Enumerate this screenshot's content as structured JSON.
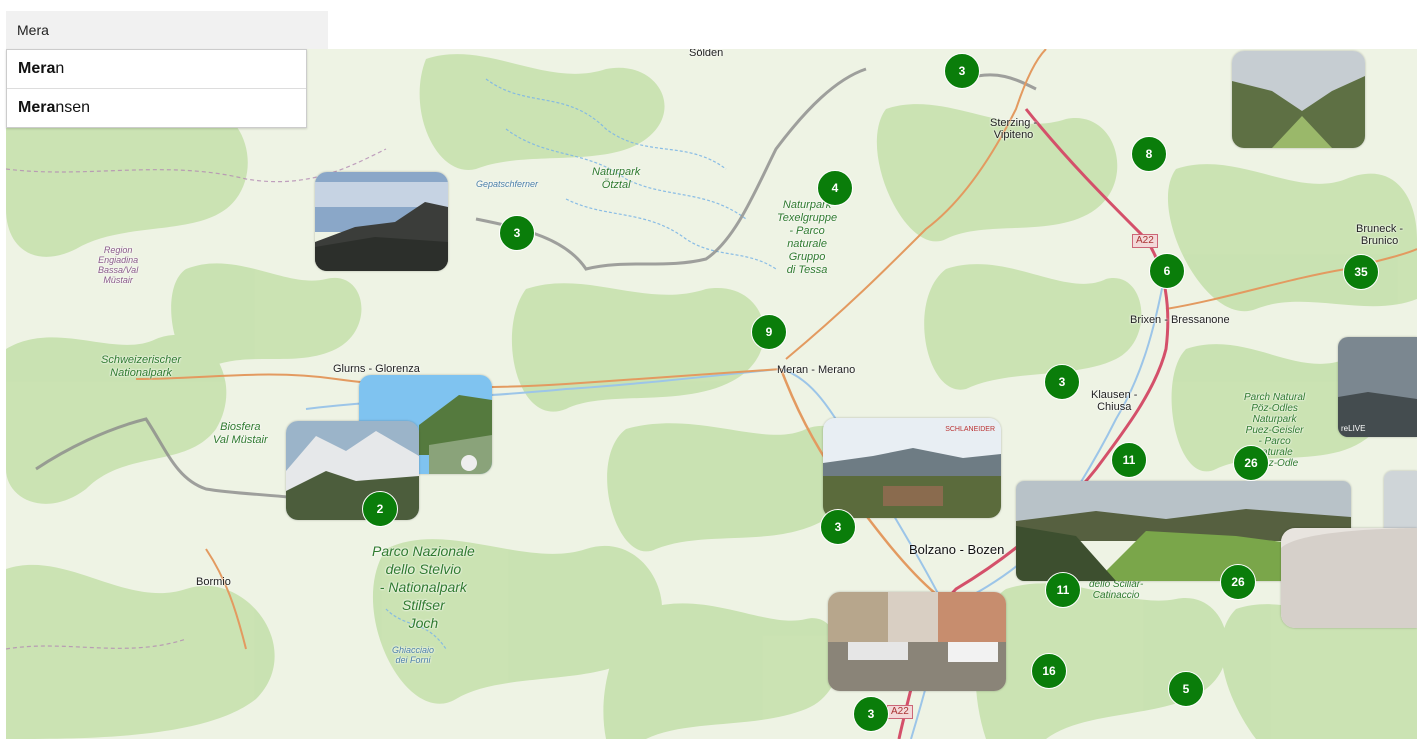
{
  "search": {
    "value": "Mera",
    "placeholder": ""
  },
  "suggestions": [
    {
      "match": "Mera",
      "rest": "n"
    },
    {
      "match": "Mera",
      "rest": "nsen"
    }
  ],
  "places": {
    "soelden": "Sölden",
    "sterzing": "Sterzing -\nVipiteno",
    "bruneck": "Bruneck -\nBrunico",
    "brixen": "Brixen - Bressanone",
    "klausen": "Klausen -\nChiusa",
    "meran": "Meran - Merano",
    "glurns": "Glurns - Glorenza",
    "bolzano": "Bolzano - Bozen",
    "bormio": "Bormio"
  },
  "parks": {
    "oetztal": "Naturpark\nÖtztal",
    "texel": "Naturpark\nTexelgruppe\n- Parco\nnaturale\nGruppo\ndi Tessa",
    "schweiz": "Schweizerischer\nNationalpark",
    "biosfera": "Biosfera\nVal Müstair",
    "stelvio": "Parco Nazionale\ndello Stelvio\n- Nationalpark\nStilfser\nJoch",
    "puez": "Parch Natural\nPöz-Odles\nNaturpark\nPuez-Geisler\n- Parco\nnaturale\nPuez-Odle",
    "sciliar": "dello Sciliar-\nCatinaccio"
  },
  "regions": {
    "engiadina": "Region\nEngiadina\nBassa/Val\nMüstair"
  },
  "waters": {
    "gepatsch": "Gepatschferner",
    "forni": "Ghiacciaio\ndei Forni"
  },
  "roads": {
    "a22_north": "A22",
    "a22_south": "A22"
  },
  "clusters": [
    {
      "id": "c1",
      "count": "3"
    },
    {
      "id": "c2",
      "count": "8"
    },
    {
      "id": "c3",
      "count": "4"
    },
    {
      "id": "c4",
      "count": "3"
    },
    {
      "id": "c5",
      "count": "6"
    },
    {
      "id": "c6",
      "count": "35"
    },
    {
      "id": "c7",
      "count": "9"
    },
    {
      "id": "c8",
      "count": "3"
    },
    {
      "id": "c9",
      "count": "11"
    },
    {
      "id": "c10",
      "count": "26"
    },
    {
      "id": "c11",
      "count": "2"
    },
    {
      "id": "c12",
      "count": "3"
    },
    {
      "id": "c13",
      "count": "11"
    },
    {
      "id": "c14",
      "count": "26"
    },
    {
      "id": "c15",
      "count": "16"
    },
    {
      "id": "c16",
      "count": "5"
    },
    {
      "id": "c17",
      "count": "3"
    }
  ],
  "webcam_overlays": {
    "relive": "reLIVE",
    "schlaneider": "SCHLANEIDER"
  },
  "colors": {
    "cluster": "#0a7d0a",
    "forest": "#c8e2b0",
    "map_bg": "#eef3e4"
  }
}
